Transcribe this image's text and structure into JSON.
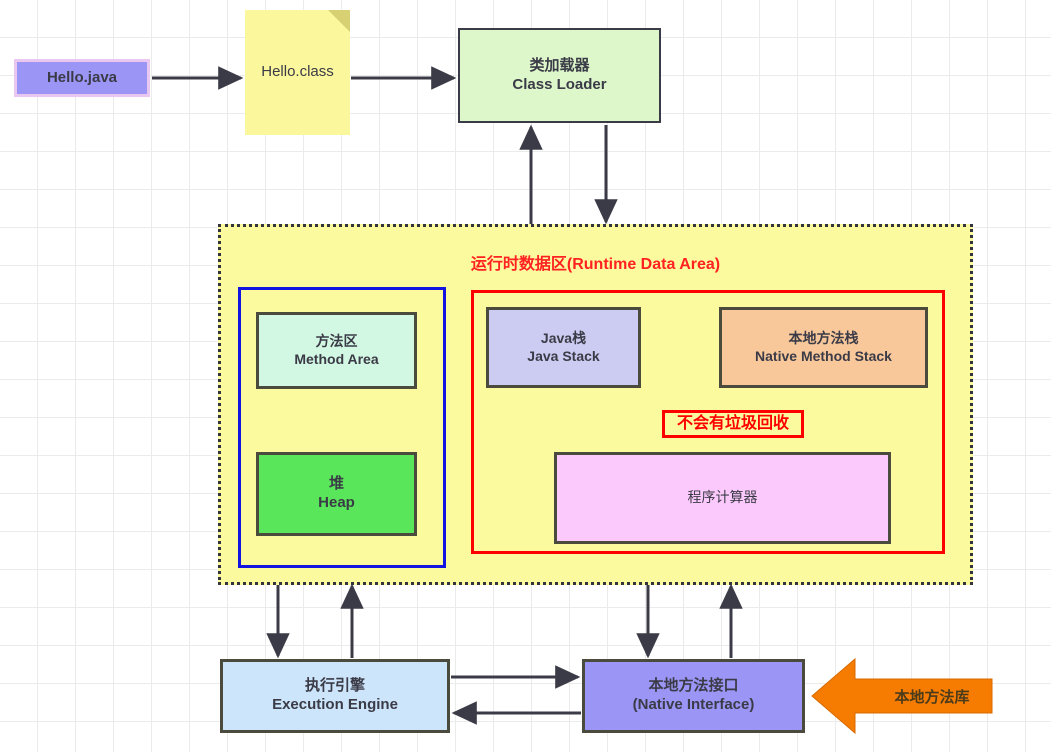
{
  "diagram": {
    "title": "JVM Architecture Diagram",
    "colors": {
      "background": "#ffffff",
      "grid": "#ebebeb",
      "runtime_fill": "#fcfa9e",
      "runtime_border": "#33333d",
      "runtime_title": "#ff2222",
      "blue_group_border": "#1414e0",
      "red_group_border": "#ff0000",
      "arrow": "#3b3b47",
      "native_lib_arrow": "#f57c00"
    }
  },
  "nodes": {
    "hello_java": {
      "label": "Hello.java",
      "fill": "#9b96f5",
      "border": "#eac7f0"
    },
    "hello_class": {
      "label": "Hello.class",
      "fill": "#fbf79c",
      "fold": "#d8d173"
    },
    "class_loader": {
      "line1": "类加载器",
      "line2": "Class Loader",
      "fill": "#ddf7cb"
    },
    "runtime_area": {
      "title": "运行时数据区(Runtime Data Area)"
    },
    "method_area": {
      "line1": "方法区",
      "line2": "Method Area",
      "fill": "#d2f7e2"
    },
    "heap": {
      "line1": "堆",
      "line2": "Heap",
      "fill": "#5ae65a"
    },
    "java_stack": {
      "line1": "Java栈",
      "line2": "Java Stack",
      "fill": "#ccccf2"
    },
    "native_method_stack": {
      "line1": "本地方法栈",
      "line2": "Native Method Stack",
      "fill": "#f8c89a"
    },
    "no_gc": {
      "label": "不会有垃圾回收",
      "color": "#ff0000"
    },
    "program_counter": {
      "label": "程序计算器",
      "fill": "#fbc9fb"
    },
    "execution_engine": {
      "line1": "执行引擎",
      "line2": "Execution Engine",
      "fill": "#cce5fa"
    },
    "native_interface": {
      "line1": "本地方法接口",
      "line2": "(Native Interface)",
      "fill": "#9b96f5"
    },
    "native_library": {
      "label": "本地方法库",
      "fill": "#f57c00"
    }
  },
  "connections": [
    {
      "name": "hello-java-to-hello-class",
      "from": "hello_java",
      "to": "hello_class",
      "direction": "right"
    },
    {
      "name": "hello-class-to-class-loader",
      "from": "hello_class",
      "to": "class_loader",
      "direction": "right"
    },
    {
      "name": "runtime-to-class-loader",
      "from": "runtime_area",
      "to": "class_loader",
      "direction": "up"
    },
    {
      "name": "class-loader-to-runtime",
      "from": "class_loader",
      "to": "runtime_area",
      "direction": "down"
    },
    {
      "name": "runtime-to-execution-engine",
      "from": "runtime_area",
      "to": "execution_engine",
      "direction": "down"
    },
    {
      "name": "execution-engine-to-runtime",
      "from": "execution_engine",
      "to": "runtime_area",
      "direction": "up"
    },
    {
      "name": "runtime-to-native-interface",
      "from": "runtime_area",
      "to": "native_interface",
      "direction": "down"
    },
    {
      "name": "native-interface-to-runtime",
      "from": "native_interface",
      "to": "runtime_area",
      "direction": "up"
    },
    {
      "name": "execution-engine-to-native-interface",
      "from": "execution_engine",
      "to": "native_interface",
      "direction": "right"
    },
    {
      "name": "native-interface-to-execution-engine",
      "from": "native_interface",
      "to": "execution_engine",
      "direction": "left"
    },
    {
      "name": "native-library-to-native-interface",
      "from": "native_library",
      "to": "native_interface",
      "direction": "left"
    }
  ]
}
